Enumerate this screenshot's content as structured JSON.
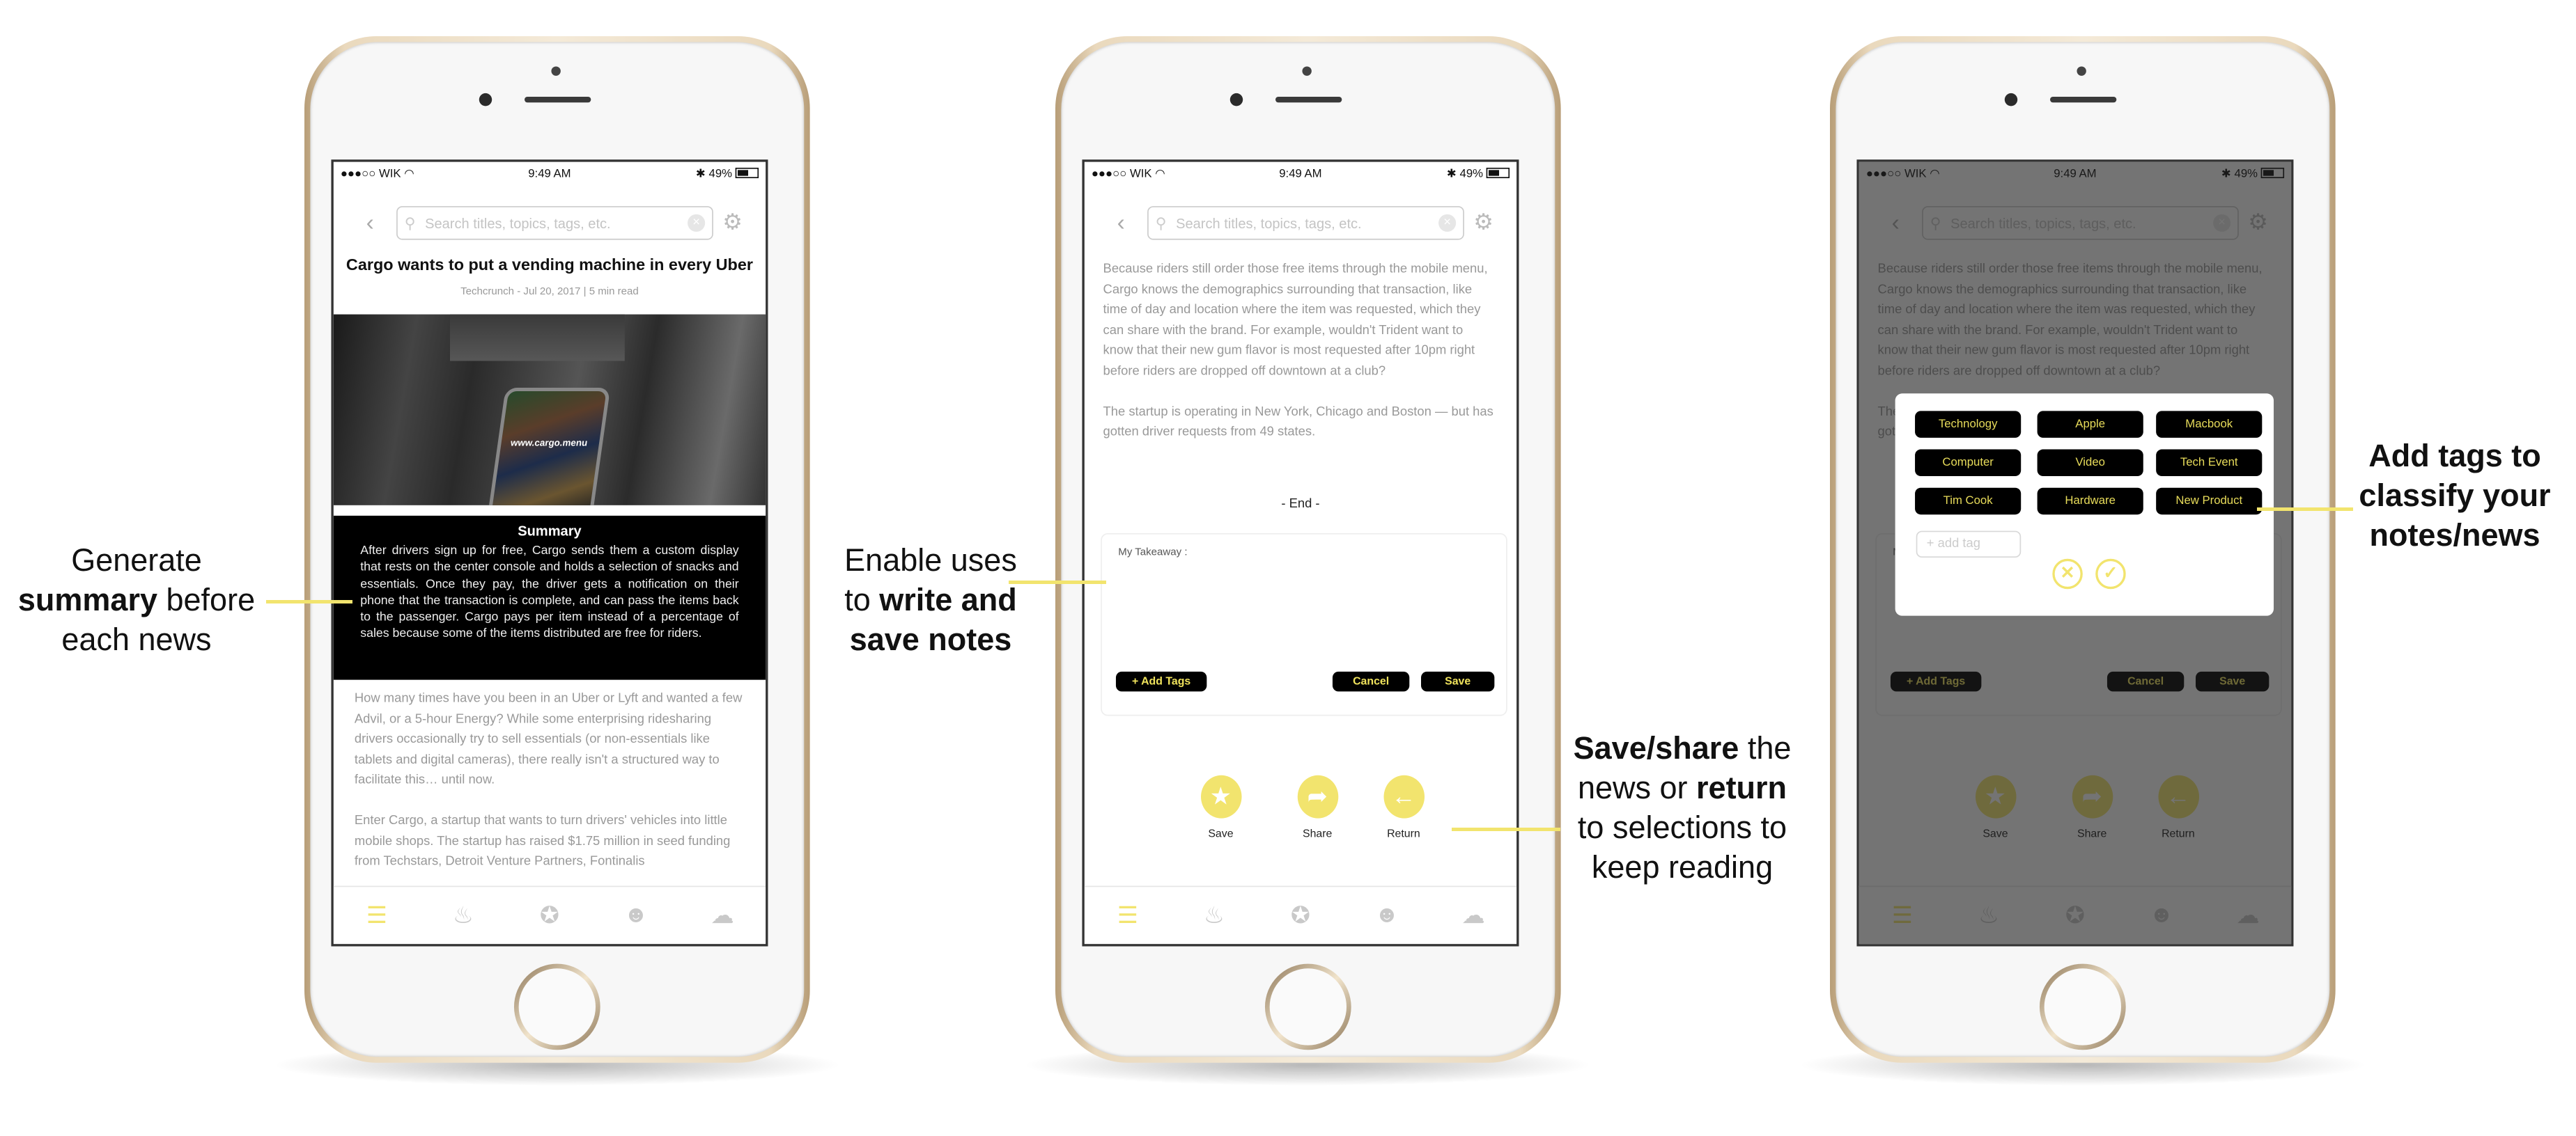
{
  "colors": {
    "accent": "#f2e46e",
    "tag_text": "#e8dc5a",
    "dark": "#000000"
  },
  "status": {
    "carrier": "●●●○○ WIK",
    "wifi": "wifi-icon",
    "time": "9:49 AM",
    "bluetooth": "✱",
    "battery": "49%"
  },
  "search": {
    "placeholder": "Search titles, topics, tags, etc."
  },
  "screen1": {
    "title": "Cargo wants to put a vending machine in every Uber",
    "meta": "Techcrunch - Jul 20, 2017 | 5 min read",
    "image_text": "www.cargo.menu",
    "summary_title": "Summary",
    "summary": "After drivers sign up for free, Cargo sends them a custom display that rests on the center console and holds a selection of snacks and essentials. Once they pay, the driver gets a notification on their phone that the transaction is complete, and can pass the items back to the passenger. Cargo pays per item instead of a percentage of sales because some of the items distributed are free for riders.",
    "paragraphs": [
      "How many times have you been in an Uber or Lyft and wanted a few Advil, or a 5-hour Energy? While some enterprising ridesharing drivers occasionally try to sell essentials (or non-essentials like tablets and digital cameras), there really isn't a structured way to facilitate this… until now.",
      "Enter Cargo, a startup that wants to turn drivers' vehicles into little mobile shops. The startup has raised $1.75 million in seed funding from Techstars, Detroit Venture Partners, Fontinalis"
    ]
  },
  "screen2": {
    "paragraphs": [
      "Because riders still order those free items through the mobile menu, Cargo knows the demographics surrounding that transaction, like time of day and location where the item was requested, which they can share with the brand. For example, wouldn't Trident want to know that their new gum flavor is most requested after 10pm right before riders are dropped off downtown at a club?",
      "The startup is operating in New York, Chicago and Boston — but has gotten driver requests from 49 states."
    ],
    "end": "- End -",
    "takeaway_label": "My Takeaway :",
    "add_tags": "+ Add Tags",
    "cancel": "Cancel",
    "save": "Save",
    "actions": [
      {
        "label": "Save",
        "icon": "star-icon"
      },
      {
        "label": "Share",
        "icon": "share-icon"
      },
      {
        "label": "Return",
        "icon": "return-icon"
      }
    ]
  },
  "screen3": {
    "tags": [
      "Technology",
      "Apple",
      "Macbook",
      "Computer",
      "Video",
      "Tech Event",
      "Tim Cook",
      "Hardware",
      "New Product"
    ],
    "add_tag_placeholder": "+ add tag"
  },
  "tabbar": [
    "menu-icon",
    "flame-icon",
    "star-icon",
    "brain-icon",
    "group-icon"
  ],
  "annotations": {
    "a1": {
      "l1": "Generate",
      "l2b": "summary",
      "l2": " before",
      "l3": "each news"
    },
    "a2": {
      "l1": "Enable uses",
      "l2": "to ",
      "l2b": "write and",
      "l3b": "save notes"
    },
    "a3": {
      "l1b": "Save/share",
      "l1": " the",
      "l2": "news or ",
      "l2b": "return",
      "l3": "to selections to",
      "l4": "keep reading"
    },
    "a4": {
      "l1": "Add tags to",
      "l2": "classify your",
      "l3": "notes/news"
    }
  }
}
